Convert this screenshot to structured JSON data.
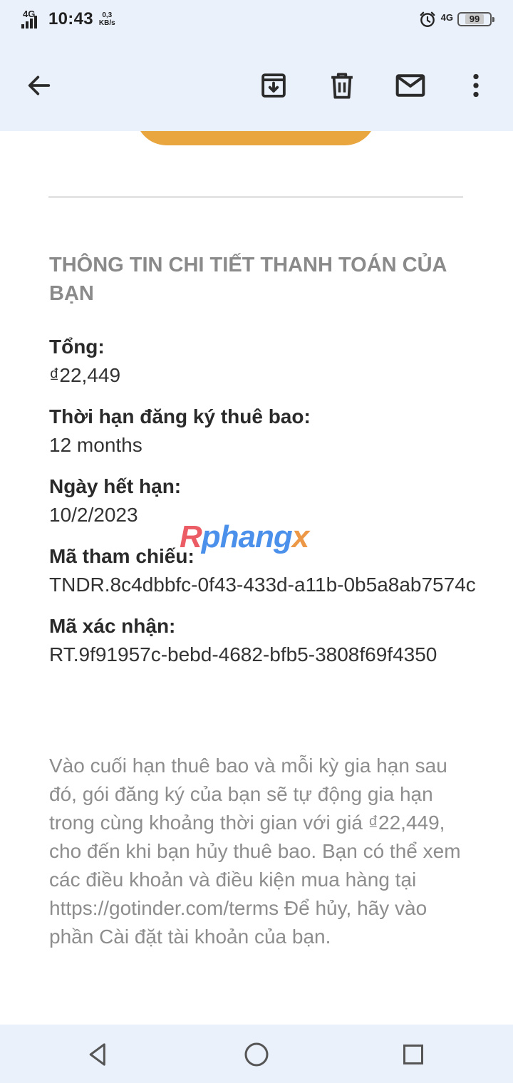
{
  "status_bar": {
    "network_left": "4G",
    "time": "10:43",
    "speed_value": "0,3",
    "speed_unit": "KB/s",
    "network_right": "4G",
    "battery": "99",
    "icons": [
      "signal-icon",
      "alarm-icon",
      "battery-icon"
    ]
  },
  "app_bar": {
    "icons": [
      "back-arrow-icon",
      "archive-icon",
      "delete-icon",
      "mark-unread-icon",
      "more-vert-icon"
    ]
  },
  "email": {
    "section_title": "THÔNG TIN CHI TIẾT THANH TOÁN CỦA BẠN",
    "details": [
      {
        "label": "Tổng:",
        "value": "₫22,449"
      },
      {
        "label": "Thời hạn đăng ký thuê bao:",
        "value": "12 months"
      },
      {
        "label": "Ngày hết hạn:",
        "value": "10/2/2023"
      },
      {
        "label": "Mã tham chiếu:",
        "value": "TNDR.8c4dbbfc-0f43-433d-a11b-0b5a8ab7574c"
      },
      {
        "label": "Mã xác nhận:",
        "value": "RT.9f91957c-bebd-4682-bfb5-3808f69f4350"
      }
    ],
    "note": "Vào cuối hạn thuê bao và mỗi kỳ gia hạn sau đó, gói đăng ký của bạn sẽ tự động gia hạn trong cùng khoảng thời gian với giá ₫22,449, cho đến khi bạn hủy thuê bao. Bạn có thể xem các điều khoản và điều kiện mua hàng tại https://gotinder.com/terms Để hủy, hãy vào phần Cài đặt tài khoản của bạn."
  },
  "watermark": {
    "first": "R",
    "middle": "phang",
    "last": "x"
  },
  "nav_bar": {
    "icons": [
      "nav-back-icon",
      "nav-home-icon",
      "nav-recents-icon"
    ]
  },
  "colors": {
    "bar_background": "#eaf1fb",
    "cta_orange": "#e9a53e",
    "muted_text": "#8d8d8d"
  }
}
